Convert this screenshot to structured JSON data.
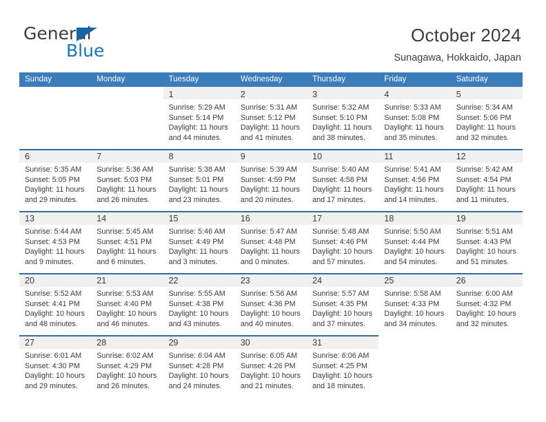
{
  "brand": {
    "name_part1": "General",
    "name_part2": "Blue",
    "triangle_icon": "triangle-icon",
    "color_primary": "#1874bd",
    "color_dark": "#3c3c3c"
  },
  "header": {
    "title": "October 2024",
    "subtitle": "Sunagawa, Hokkaido, Japan"
  },
  "calendar": {
    "header_bg": "#3b7cbb",
    "daynum_band_bg": "#f0f0f0",
    "row_rule_color": "#2e6ca4",
    "weekdays": [
      "Sunday",
      "Monday",
      "Tuesday",
      "Wednesday",
      "Thursday",
      "Friday",
      "Saturday"
    ],
    "weeks": [
      [
        {
          "day": "",
          "sunrise": "",
          "sunset": "",
          "daylight1": "",
          "daylight2": ""
        },
        {
          "day": "",
          "sunrise": "",
          "sunset": "",
          "daylight1": "",
          "daylight2": ""
        },
        {
          "day": "1",
          "sunrise": "Sunrise: 5:29 AM",
          "sunset": "Sunset: 5:14 PM",
          "daylight1": "Daylight: 11 hours",
          "daylight2": "and 44 minutes."
        },
        {
          "day": "2",
          "sunrise": "Sunrise: 5:31 AM",
          "sunset": "Sunset: 5:12 PM",
          "daylight1": "Daylight: 11 hours",
          "daylight2": "and 41 minutes."
        },
        {
          "day": "3",
          "sunrise": "Sunrise: 5:32 AM",
          "sunset": "Sunset: 5:10 PM",
          "daylight1": "Daylight: 11 hours",
          "daylight2": "and 38 minutes."
        },
        {
          "day": "4",
          "sunrise": "Sunrise: 5:33 AM",
          "sunset": "Sunset: 5:08 PM",
          "daylight1": "Daylight: 11 hours",
          "daylight2": "and 35 minutes."
        },
        {
          "day": "5",
          "sunrise": "Sunrise: 5:34 AM",
          "sunset": "Sunset: 5:06 PM",
          "daylight1": "Daylight: 11 hours",
          "daylight2": "and 32 minutes."
        }
      ],
      [
        {
          "day": "6",
          "sunrise": "Sunrise: 5:35 AM",
          "sunset": "Sunset: 5:05 PM",
          "daylight1": "Daylight: 11 hours",
          "daylight2": "and 29 minutes."
        },
        {
          "day": "7",
          "sunrise": "Sunrise: 5:36 AM",
          "sunset": "Sunset: 5:03 PM",
          "daylight1": "Daylight: 11 hours",
          "daylight2": "and 26 minutes."
        },
        {
          "day": "8",
          "sunrise": "Sunrise: 5:38 AM",
          "sunset": "Sunset: 5:01 PM",
          "daylight1": "Daylight: 11 hours",
          "daylight2": "and 23 minutes."
        },
        {
          "day": "9",
          "sunrise": "Sunrise: 5:39 AM",
          "sunset": "Sunset: 4:59 PM",
          "daylight1": "Daylight: 11 hours",
          "daylight2": "and 20 minutes."
        },
        {
          "day": "10",
          "sunrise": "Sunrise: 5:40 AM",
          "sunset": "Sunset: 4:58 PM",
          "daylight1": "Daylight: 11 hours",
          "daylight2": "and 17 minutes."
        },
        {
          "day": "11",
          "sunrise": "Sunrise: 5:41 AM",
          "sunset": "Sunset: 4:56 PM",
          "daylight1": "Daylight: 11 hours",
          "daylight2": "and 14 minutes."
        },
        {
          "day": "12",
          "sunrise": "Sunrise: 5:42 AM",
          "sunset": "Sunset: 4:54 PM",
          "daylight1": "Daylight: 11 hours",
          "daylight2": "and 11 minutes."
        }
      ],
      [
        {
          "day": "13",
          "sunrise": "Sunrise: 5:44 AM",
          "sunset": "Sunset: 4:53 PM",
          "daylight1": "Daylight: 11 hours",
          "daylight2": "and 9 minutes."
        },
        {
          "day": "14",
          "sunrise": "Sunrise: 5:45 AM",
          "sunset": "Sunset: 4:51 PM",
          "daylight1": "Daylight: 11 hours",
          "daylight2": "and 6 minutes."
        },
        {
          "day": "15",
          "sunrise": "Sunrise: 5:46 AM",
          "sunset": "Sunset: 4:49 PM",
          "daylight1": "Daylight: 11 hours",
          "daylight2": "and 3 minutes."
        },
        {
          "day": "16",
          "sunrise": "Sunrise: 5:47 AM",
          "sunset": "Sunset: 4:48 PM",
          "daylight1": "Daylight: 11 hours",
          "daylight2": "and 0 minutes."
        },
        {
          "day": "17",
          "sunrise": "Sunrise: 5:48 AM",
          "sunset": "Sunset: 4:46 PM",
          "daylight1": "Daylight: 10 hours",
          "daylight2": "and 57 minutes."
        },
        {
          "day": "18",
          "sunrise": "Sunrise: 5:50 AM",
          "sunset": "Sunset: 4:44 PM",
          "daylight1": "Daylight: 10 hours",
          "daylight2": "and 54 minutes."
        },
        {
          "day": "19",
          "sunrise": "Sunrise: 5:51 AM",
          "sunset": "Sunset: 4:43 PM",
          "daylight1": "Daylight: 10 hours",
          "daylight2": "and 51 minutes."
        }
      ],
      [
        {
          "day": "20",
          "sunrise": "Sunrise: 5:52 AM",
          "sunset": "Sunset: 4:41 PM",
          "daylight1": "Daylight: 10 hours",
          "daylight2": "and 48 minutes."
        },
        {
          "day": "21",
          "sunrise": "Sunrise: 5:53 AM",
          "sunset": "Sunset: 4:40 PM",
          "daylight1": "Daylight: 10 hours",
          "daylight2": "and 46 minutes."
        },
        {
          "day": "22",
          "sunrise": "Sunrise: 5:55 AM",
          "sunset": "Sunset: 4:38 PM",
          "daylight1": "Daylight: 10 hours",
          "daylight2": "and 43 minutes."
        },
        {
          "day": "23",
          "sunrise": "Sunrise: 5:56 AM",
          "sunset": "Sunset: 4:36 PM",
          "daylight1": "Daylight: 10 hours",
          "daylight2": "and 40 minutes."
        },
        {
          "day": "24",
          "sunrise": "Sunrise: 5:57 AM",
          "sunset": "Sunset: 4:35 PM",
          "daylight1": "Daylight: 10 hours",
          "daylight2": "and 37 minutes."
        },
        {
          "day": "25",
          "sunrise": "Sunrise: 5:58 AM",
          "sunset": "Sunset: 4:33 PM",
          "daylight1": "Daylight: 10 hours",
          "daylight2": "and 34 minutes."
        },
        {
          "day": "26",
          "sunrise": "Sunrise: 6:00 AM",
          "sunset": "Sunset: 4:32 PM",
          "daylight1": "Daylight: 10 hours",
          "daylight2": "and 32 minutes."
        }
      ],
      [
        {
          "day": "27",
          "sunrise": "Sunrise: 6:01 AM",
          "sunset": "Sunset: 4:30 PM",
          "daylight1": "Daylight: 10 hours",
          "daylight2": "and 29 minutes."
        },
        {
          "day": "28",
          "sunrise": "Sunrise: 6:02 AM",
          "sunset": "Sunset: 4:29 PM",
          "daylight1": "Daylight: 10 hours",
          "daylight2": "and 26 minutes."
        },
        {
          "day": "29",
          "sunrise": "Sunrise: 6:04 AM",
          "sunset": "Sunset: 4:28 PM",
          "daylight1": "Daylight: 10 hours",
          "daylight2": "and 24 minutes."
        },
        {
          "day": "30",
          "sunrise": "Sunrise: 6:05 AM",
          "sunset": "Sunset: 4:26 PM",
          "daylight1": "Daylight: 10 hours",
          "daylight2": "and 21 minutes."
        },
        {
          "day": "31",
          "sunrise": "Sunrise: 6:06 AM",
          "sunset": "Sunset: 4:25 PM",
          "daylight1": "Daylight: 10 hours",
          "daylight2": "and 18 minutes."
        },
        {
          "day": "",
          "sunrise": "",
          "sunset": "",
          "daylight1": "",
          "daylight2": ""
        },
        {
          "day": "",
          "sunrise": "",
          "sunset": "",
          "daylight1": "",
          "daylight2": ""
        }
      ]
    ]
  }
}
